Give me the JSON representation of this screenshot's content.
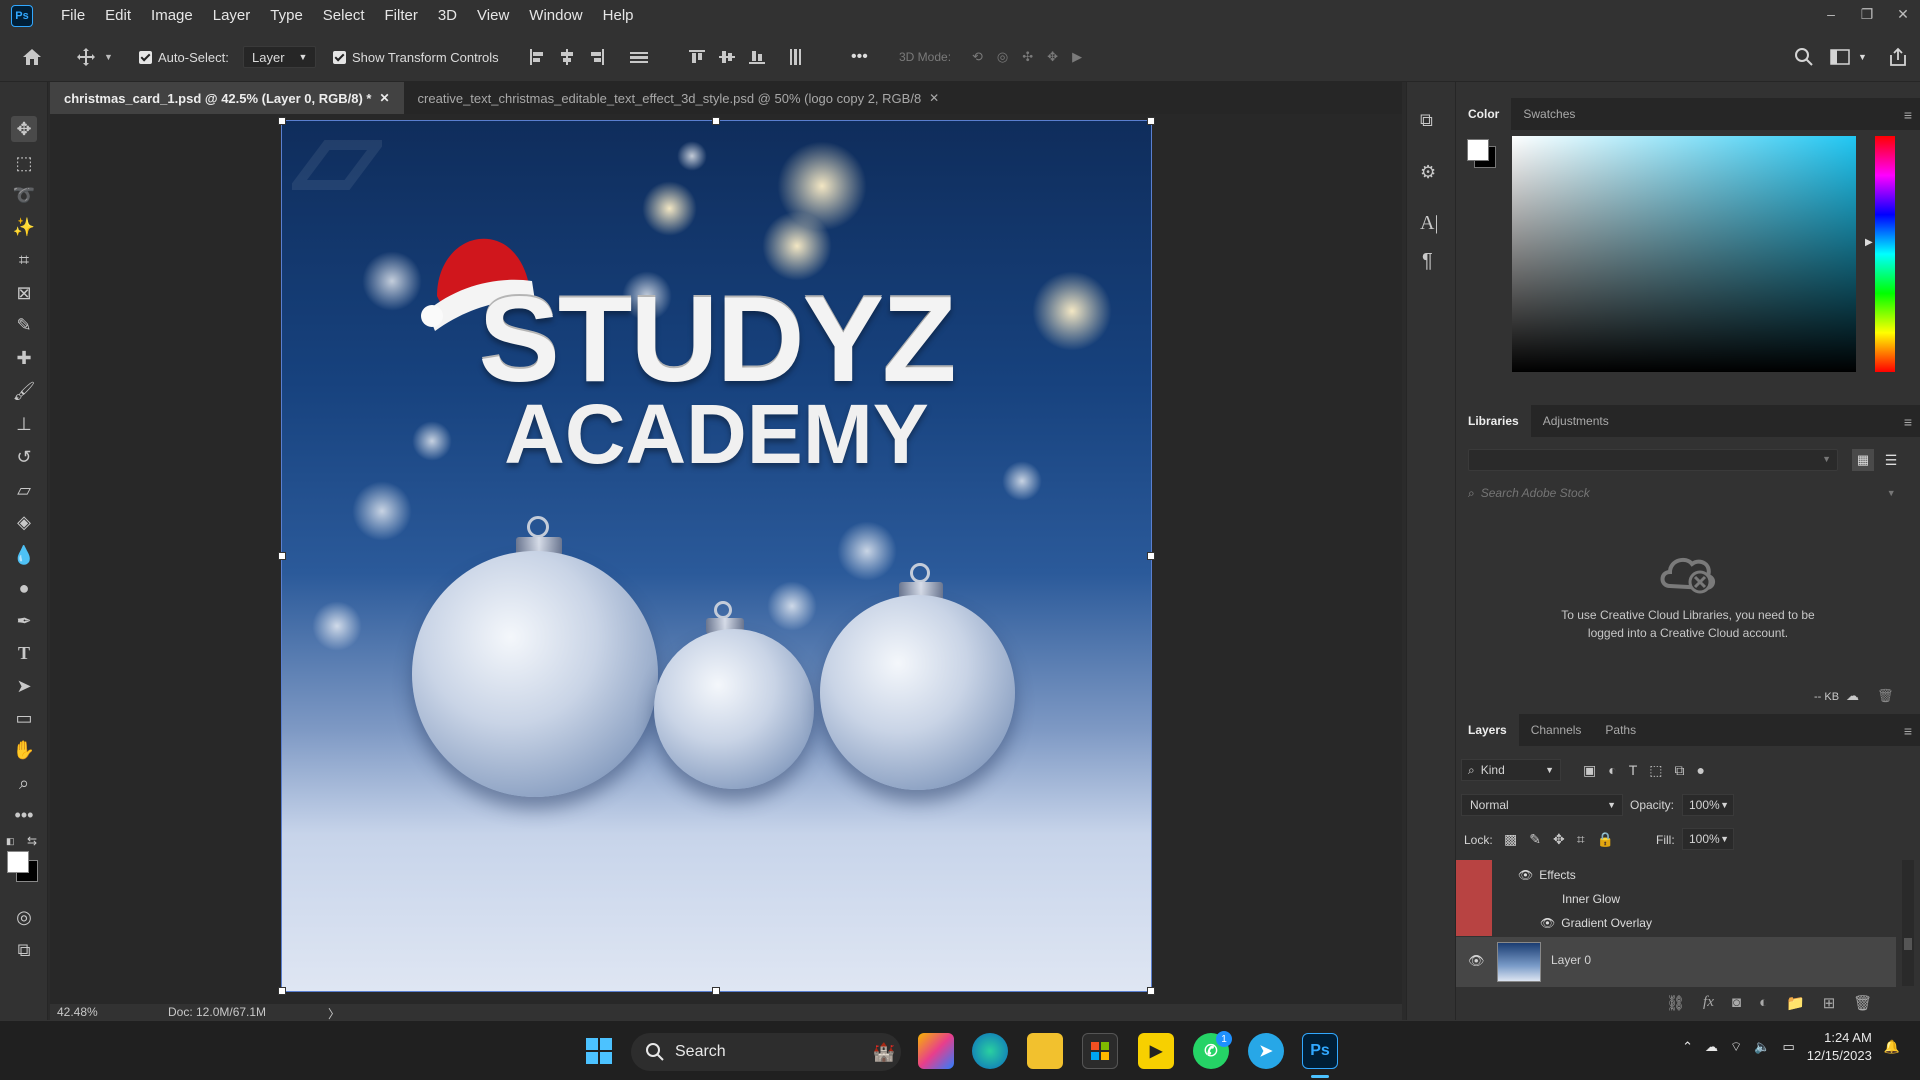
{
  "app": {
    "logo": "Ps"
  },
  "menu": [
    "File",
    "Edit",
    "Image",
    "Layer",
    "Type",
    "Select",
    "Filter",
    "3D",
    "View",
    "Window",
    "Help"
  ],
  "window_controls": {
    "minimize": "–",
    "restore": "❐",
    "close": "✕"
  },
  "options_bar": {
    "auto_select_label": "Auto-Select:",
    "auto_select_target": "Layer",
    "show_transform_label": "Show Transform Controls",
    "more": "•••",
    "mode_3d_label": "3D Mode:"
  },
  "tabs": [
    {
      "label": "christmas_card_1.psd @ 42.5% (Layer 0, RGB/8) *",
      "close": "✕"
    },
    {
      "label": "creative_text_christmas_editable_text_effect_3d_style.psd @ 50% (logo copy 2, RGB/8",
      "close": "✕"
    }
  ],
  "canvas": {
    "title_line1": "STUDYZ",
    "title_line2": "ACADEMY"
  },
  "status": {
    "zoom": "42.48%",
    "doc": "Doc: 12.0M/67.1M",
    "arrow": "〉"
  },
  "color_panel": {
    "tabs": [
      "Color",
      "Swatches"
    ]
  },
  "libraries_panel": {
    "tabs": [
      "Libraries",
      "Adjustments"
    ],
    "search_placeholder": "Search Adobe Stock",
    "message": "To use Creative Cloud Libraries, you need to be logged into a Creative Cloud account.",
    "kb": "-- KB"
  },
  "layers_panel": {
    "tabs": [
      "Layers",
      "Channels",
      "Paths"
    ],
    "filter_kind": "Kind",
    "blend_mode": "Normal",
    "opacity_label": "Opacity:",
    "opacity_value": "100%",
    "lock_label": "Lock:",
    "fill_label": "Fill:",
    "fill_value": "100%",
    "effects_label": "Effects",
    "effect_items": [
      "Inner Glow",
      "Gradient Overlay"
    ],
    "layer_name": "Layer 0"
  },
  "taskbar": {
    "search_label": "Search",
    "whatsapp_badge": "1",
    "time": "1:24 AM",
    "date": "12/15/2023"
  },
  "colors": {
    "accent": "#31a8ff",
    "effects_swatch": "#b84342",
    "canvas_bg_top": "#0f2d5c"
  }
}
